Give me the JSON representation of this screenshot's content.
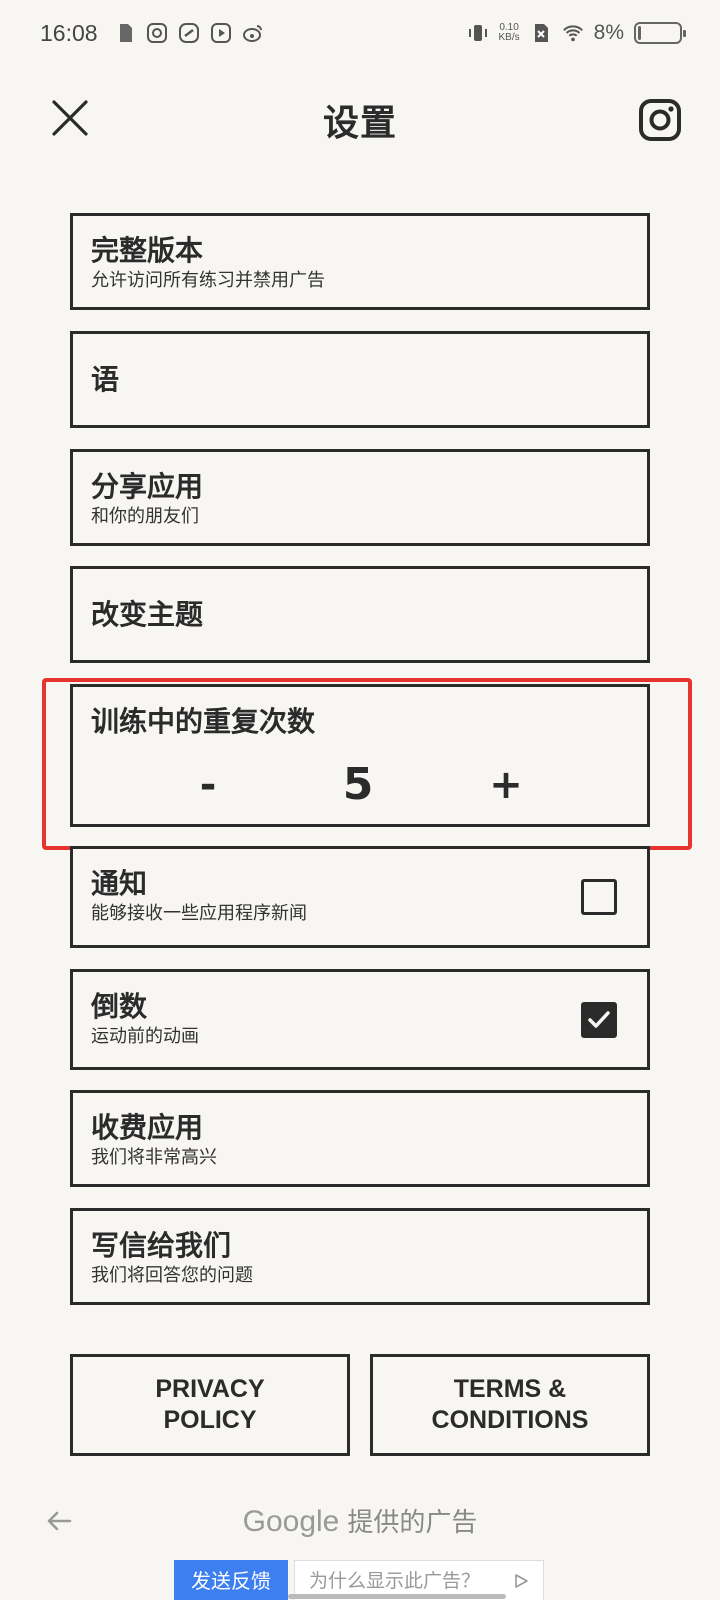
{
  "status_bar": {
    "time": "16:08",
    "net_speed_value": "0.10",
    "net_speed_unit": "KB/s",
    "battery_percent": "8%",
    "battery_level": 0.08
  },
  "header": {
    "title": "设置"
  },
  "settings": {
    "full_version": {
      "title": "完整版本",
      "subtitle": "允许访问所有练习并禁用广告"
    },
    "language": {
      "title": "语"
    },
    "share_app": {
      "title": "分享应用",
      "subtitle": "和你的朋友们"
    },
    "change_theme": {
      "title": "改变主题"
    },
    "repetitions": {
      "title": "训练中的重复次数",
      "minus": "-",
      "value": "5",
      "plus": "+"
    },
    "notifications": {
      "title": "通知",
      "subtitle": "能够接收一些应用程序新闻",
      "checked": false
    },
    "countdown": {
      "title": "倒数",
      "subtitle": "运动前的动画",
      "checked": true
    },
    "rate_app": {
      "title": "收费应用",
      "subtitle": "我们将非常高兴"
    },
    "write_us": {
      "title": "写信给我们",
      "subtitle": "我们将回答您的问题"
    }
  },
  "footer_buttons": {
    "privacy": "PRIVACY\nPOLICY",
    "terms": "TERMS &\nCONDITIONS"
  },
  "ad": {
    "google": "Google",
    "provider_text": "提供的广告",
    "feedback_button": "发送反馈",
    "why_text": "为什么显示此广告？"
  },
  "colors": {
    "background": "#f7f6f3",
    "ink": "#2b2b2b",
    "highlight": "#e8342e",
    "ad_button": "#3d7ef0"
  }
}
